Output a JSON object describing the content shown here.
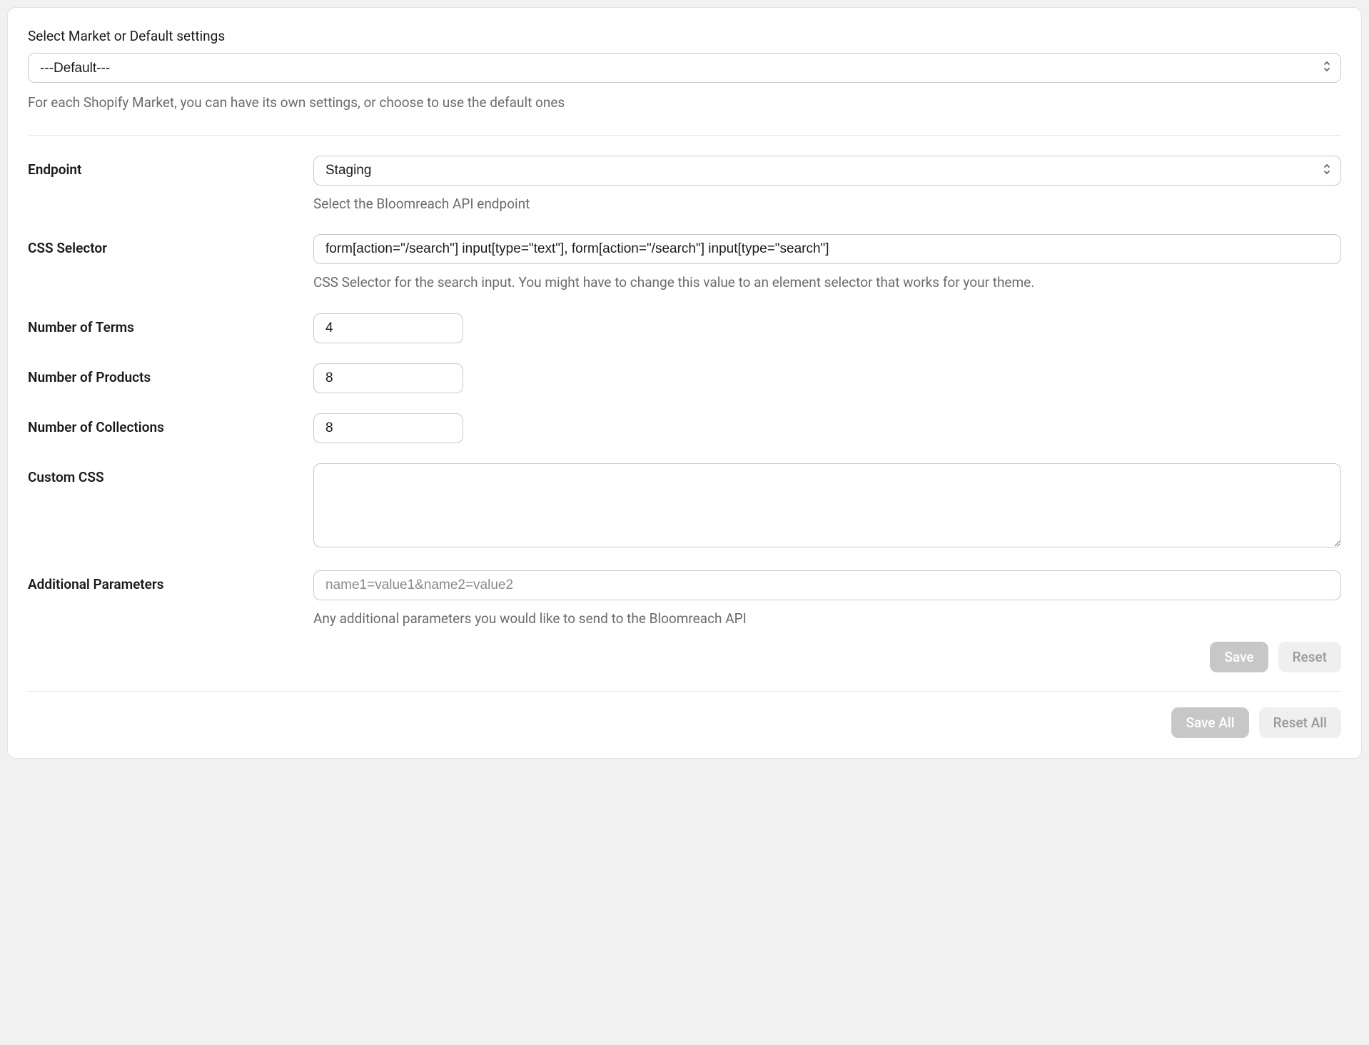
{
  "market": {
    "label": "Select Market or Default settings",
    "selected": "---Default---",
    "help": "For each Shopify Market, you can have its own settings, or choose to use the default ones"
  },
  "fields": {
    "endpoint": {
      "label": "Endpoint",
      "selected": "Staging",
      "help": "Select the Bloomreach API endpoint"
    },
    "css_selector": {
      "label": "CSS Selector",
      "value": "form[action=\"/search\"] input[type=\"text\"], form[action=\"/search\"] input[type=\"search\"]",
      "help": "CSS Selector for the search input. You might have to change this value to an element selector that works for your theme."
    },
    "num_terms": {
      "label": "Number of Terms",
      "value": "4"
    },
    "num_products": {
      "label": "Number of Products",
      "value": "8"
    },
    "num_collections": {
      "label": "Number of Collections",
      "value": "8"
    },
    "custom_css": {
      "label": "Custom CSS",
      "value": ""
    },
    "additional_params": {
      "label": "Additional Parameters",
      "placeholder": "name1=value1&name2=value2",
      "value": "",
      "help": "Any additional parameters you would like to send to the Bloomreach API"
    }
  },
  "buttons": {
    "save": "Save",
    "reset": "Reset",
    "save_all": "Save All",
    "reset_all": "Reset All"
  }
}
